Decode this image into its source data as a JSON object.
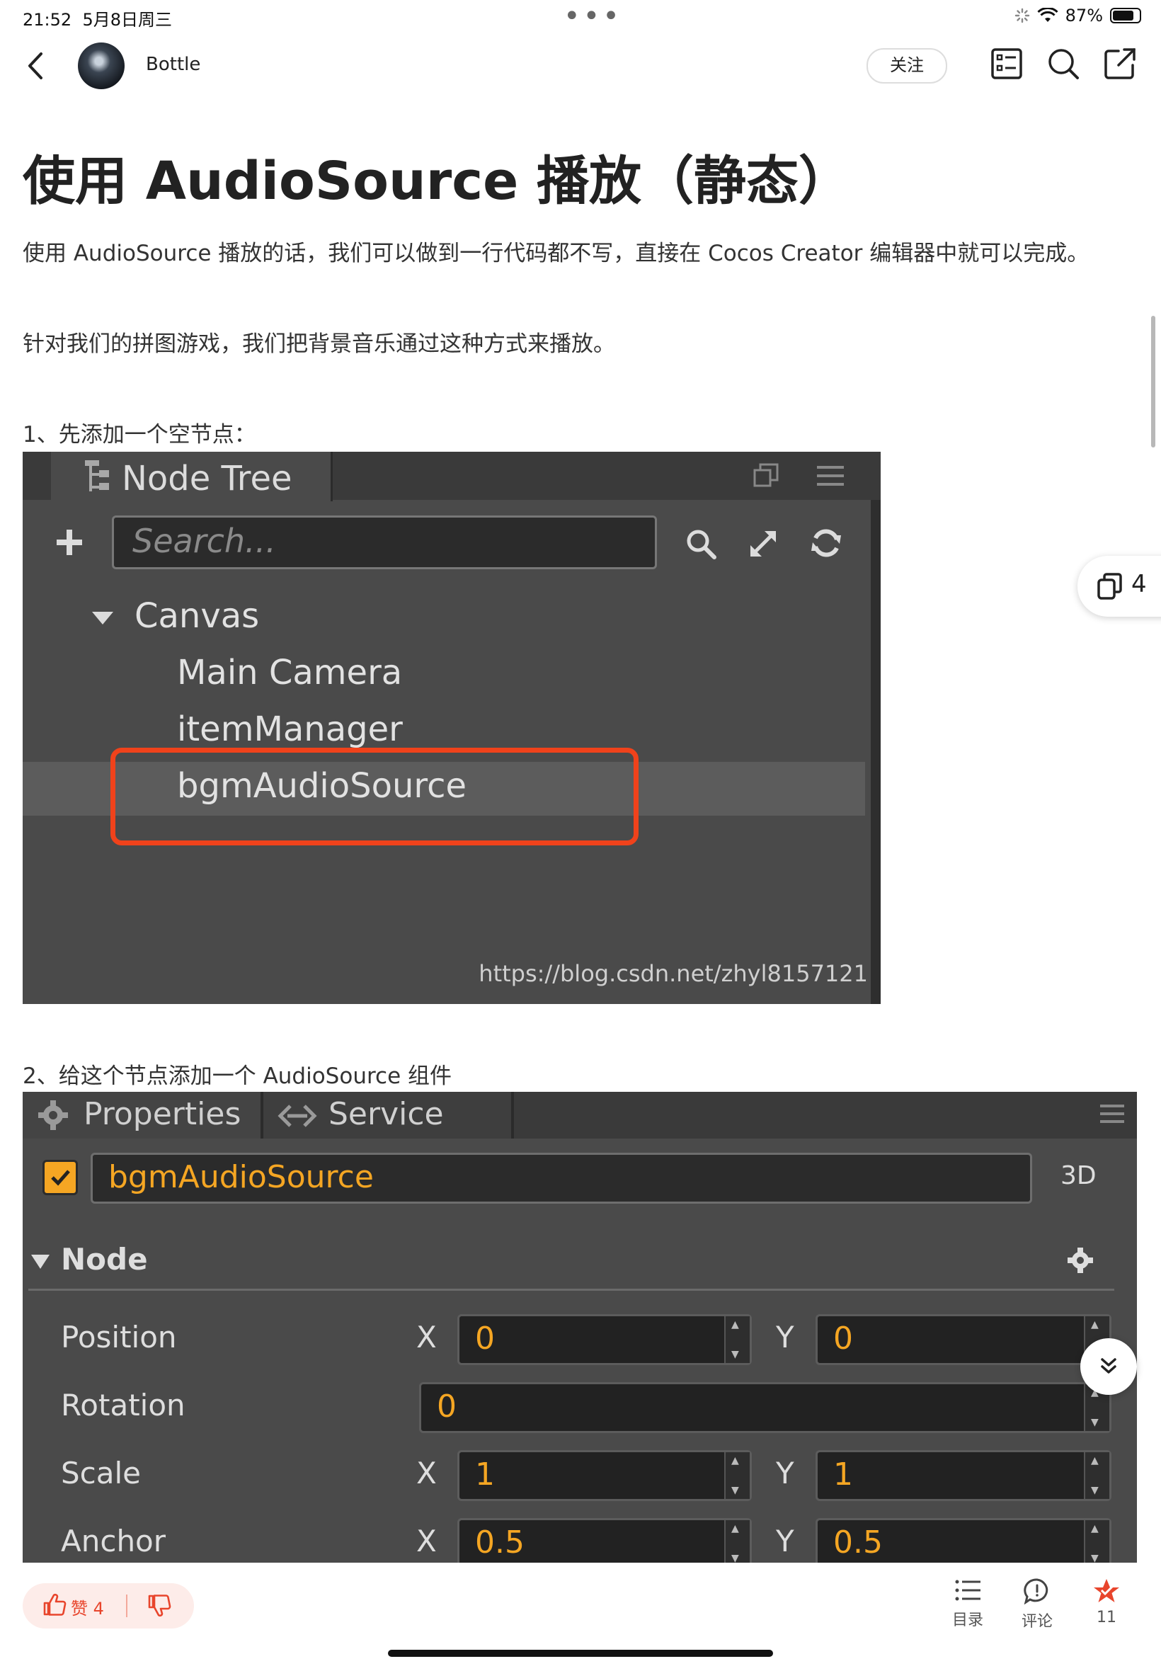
{
  "status_bar": {
    "time": "21:52",
    "date": "5月8日周三",
    "battery": "87%",
    "battery_level": 0.87
  },
  "nav": {
    "author": "Bottle",
    "follow_label": "关注",
    "icons": [
      "back-icon",
      "checklist-icon",
      "search-icon",
      "share-icon"
    ]
  },
  "article": {
    "title": "使用 AudioSource 播放（静态）",
    "paragraphs": [
      "使用 AudioSource 播放的话，我们可以做到一行代码都不写，直接在 Cocos Creator 编辑器中就可以完成。",
      "针对我们的拼图游戏，我们把背景音乐通过这种方式来播放。",
      "1、先添加一个空节点：",
      "2、给这个节点添加一个 AudioSource 组件"
    ]
  },
  "node_tree": {
    "tab_title": "Node Tree",
    "search_placeholder": "Search...",
    "items": [
      "Canvas",
      "Main Camera",
      "itemManager",
      "bgmAudioSource"
    ],
    "watermark": "https://blog.csdn.net/zhyl8157121"
  },
  "properties": {
    "tabs": [
      "Properties",
      "Service"
    ],
    "node_name": "bgmAudioSource",
    "mode_label": "3D",
    "section": "Node",
    "rows": [
      {
        "label": "Position",
        "x_axis": "X",
        "x": "0",
        "y_axis": "Y",
        "y": "0"
      },
      {
        "label": "Rotation",
        "value": "0"
      },
      {
        "label": "Scale",
        "x_axis": "X",
        "x": "1",
        "y_axis": "Y",
        "y": "1"
      },
      {
        "label": "Anchor",
        "x_axis": "X",
        "x": "0.5",
        "y_axis": "Y",
        "y": "0.5"
      }
    ]
  },
  "floating": {
    "copy_count": "4"
  },
  "bottom_bar": {
    "like_label": "赞",
    "like_count": "4",
    "toc_label": "目录",
    "comment_label": "评论",
    "collect_count": "11"
  },
  "colors": {
    "accent": "#e8452c",
    "editor_bg": "#4a4a4a",
    "editor_value": "#f5a623",
    "highlight_box": "#f0421b"
  }
}
